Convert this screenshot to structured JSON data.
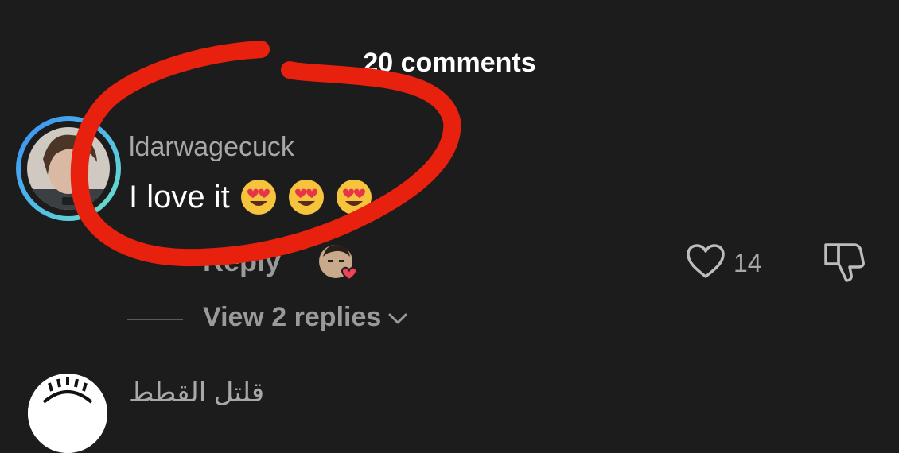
{
  "header": {
    "comment_count_label": "20 comments"
  },
  "comment": {
    "username": "ldarwagecuck",
    "text": "I love it",
    "emojis": [
      "heart-eyes-emoji",
      "heart-eyes-emoji",
      "heart-eyes-emoji"
    ],
    "reply_label": "Reply",
    "like_count": "14",
    "view_replies_label": "View 2 replies"
  },
  "next_comment": {
    "username": "قلتل القطط"
  },
  "icons": {
    "like": "heart-outline-icon",
    "dislike": "thumbs-down-icon",
    "chevron": "chevron-down-icon",
    "creator_liked": "creator-liked-heart-icon"
  },
  "colors": {
    "background": "#1c1c1c",
    "annotation_red": "#e8200e",
    "ring_start": "#3a8df5",
    "ring_end": "#6ee6c4",
    "liked_heart": "#f0425b"
  }
}
